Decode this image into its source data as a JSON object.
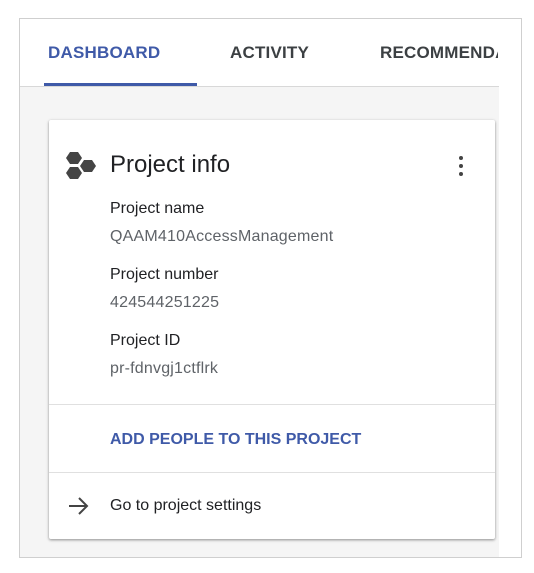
{
  "tabs": [
    {
      "label": "DASHBOARD",
      "active": true
    },
    {
      "label": "ACTIVITY",
      "active": false
    },
    {
      "label": "RECOMMENDATIONS",
      "active": false
    }
  ],
  "card": {
    "title": "Project info",
    "icon": "hexagons-icon",
    "fields": [
      {
        "label": "Project name",
        "value": "QAAM410AccessManagement"
      },
      {
        "label": "Project number",
        "value": "424544251225"
      },
      {
        "label": "Project ID",
        "value": "pr-fdnvgj1ctflrk"
      }
    ],
    "add_people_label": "ADD PEOPLE TO THIS PROJECT",
    "settings_label": "Go to project settings"
  },
  "colors": {
    "accent": "#3f5aa8",
    "text": "#202124",
    "secondary_text": "#5f6368",
    "icon": "#444444"
  }
}
